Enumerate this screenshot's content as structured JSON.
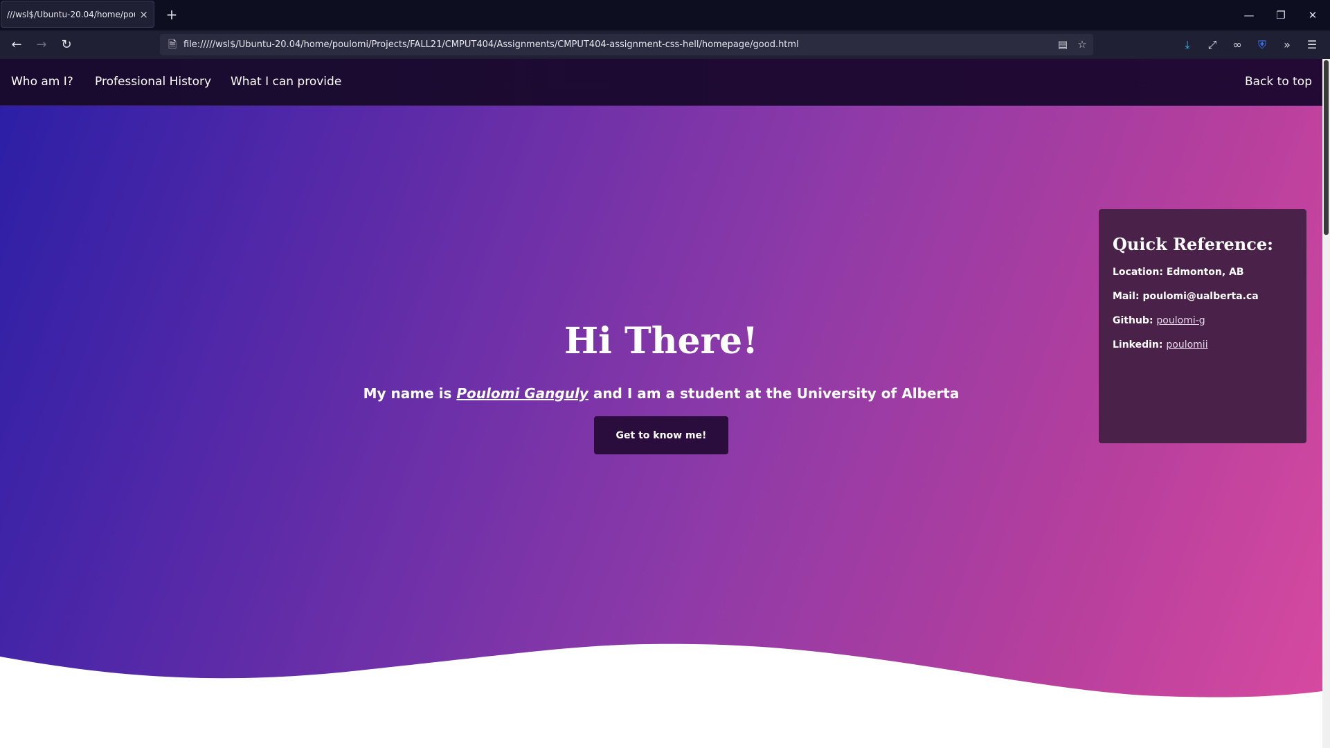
{
  "browser": {
    "tab_title": "///wsl$/Ubuntu-20.04/home/poulo",
    "tab_close": "×",
    "new_tab": "+",
    "url": "file://///wsl$/Ubuntu-20.04/home/poulomi/Projects/FALL21/CMPUT404/Assignments/CMPUT404-assignment-css-hell/homepage/good.html",
    "icons": [
      "back-icon",
      "forward-icon",
      "reload-icon",
      "page-icon",
      "reader-view-icon",
      "bookmark-star-icon",
      "download-icon",
      "fullscreen-icon",
      "mask-icon",
      "shield-icon",
      "overflow-icon",
      "menu-icon"
    ],
    "download_icon_color": "#35b6f2"
  },
  "nav": {
    "links": [
      "Who am I?",
      "Professional History",
      "What I can provide"
    ],
    "back_to_top": "Back to top"
  },
  "hero": {
    "title": "Hi There!",
    "sub_before": "My name is ",
    "name": "Poulomi Ganguly",
    "sub_after": " and I am a student at the University of Alberta",
    "button": "Get to know me!",
    "gradient_start": "#2c1fa6",
    "gradient_end": "#d84aa0"
  },
  "quick_reference": {
    "title": "Quick Reference:",
    "location_label": "Location: ",
    "location": "Edmonton, AB",
    "mail_label": "Mail: ",
    "mail": "poulomi@ualberta.ca",
    "github_label": "Github: ",
    "github": "poulomi-g",
    "linkedin_label": "Linkedin: ",
    "linkedin": "poulomii",
    "background": "#4a2148"
  }
}
